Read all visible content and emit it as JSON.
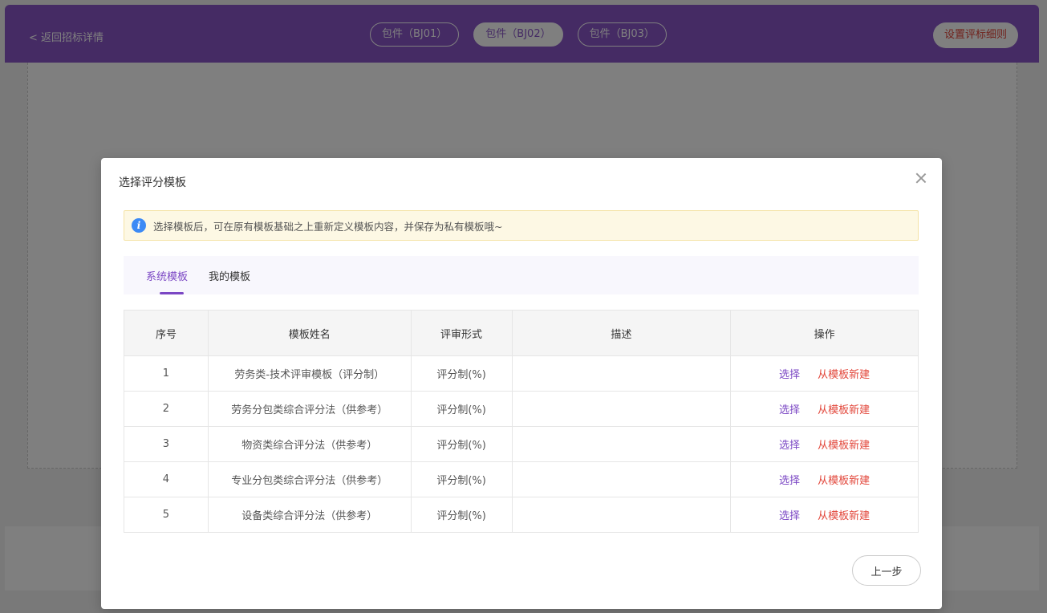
{
  "page": {
    "back_link": "< 返回招标详情",
    "package_tabs": [
      "包件（BJ01）",
      "包件（BJ02）",
      "包件（BJ03）"
    ],
    "set_rule_button": "设置评标细则",
    "accent_color": "#8a56c9"
  },
  "modal": {
    "title": "选择评分模板",
    "notice": "选择模板后，可在原有模板基础之上重新定义模板内容，并保存为私有模板哦~",
    "tabs": [
      "系统模板",
      "我的模板"
    ],
    "active_tab": "系统模板",
    "table": {
      "headers": [
        "序号",
        "模板姓名",
        "评审形式",
        "描述",
        "操作"
      ],
      "rows": [
        {
          "num": "1",
          "name": "劳务类-技术评审模板（评分制）",
          "type": "评分制(%)",
          "desc": "",
          "select": "选择",
          "new": "从模板新建"
        },
        {
          "num": "2",
          "name": "劳务分包类综合评分法（供参考）",
          "type": "评分制(%)",
          "desc": "",
          "select": "选择",
          "new": "从模板新建"
        },
        {
          "num": "3",
          "name": "物资类综合评分法（供参考）",
          "type": "评分制(%)",
          "desc": "",
          "select": "选择",
          "new": "从模板新建"
        },
        {
          "num": "4",
          "name": "专业分包类综合评分法（供参考）",
          "type": "评分制(%)",
          "desc": "",
          "select": "选择",
          "new": "从模板新建"
        },
        {
          "num": "5",
          "name": "设备类综合评分法（供参考）",
          "type": "评分制(%)",
          "desc": "",
          "select": "选择",
          "new": "从模板新建"
        }
      ]
    },
    "prev_button": "上一步",
    "close_icon": "close-icon",
    "info_icon": "info-icon",
    "colors": {
      "select": "#7b47c4",
      "new_from_template": "#e2463a",
      "notice_bg": "#fdf8e4"
    }
  }
}
